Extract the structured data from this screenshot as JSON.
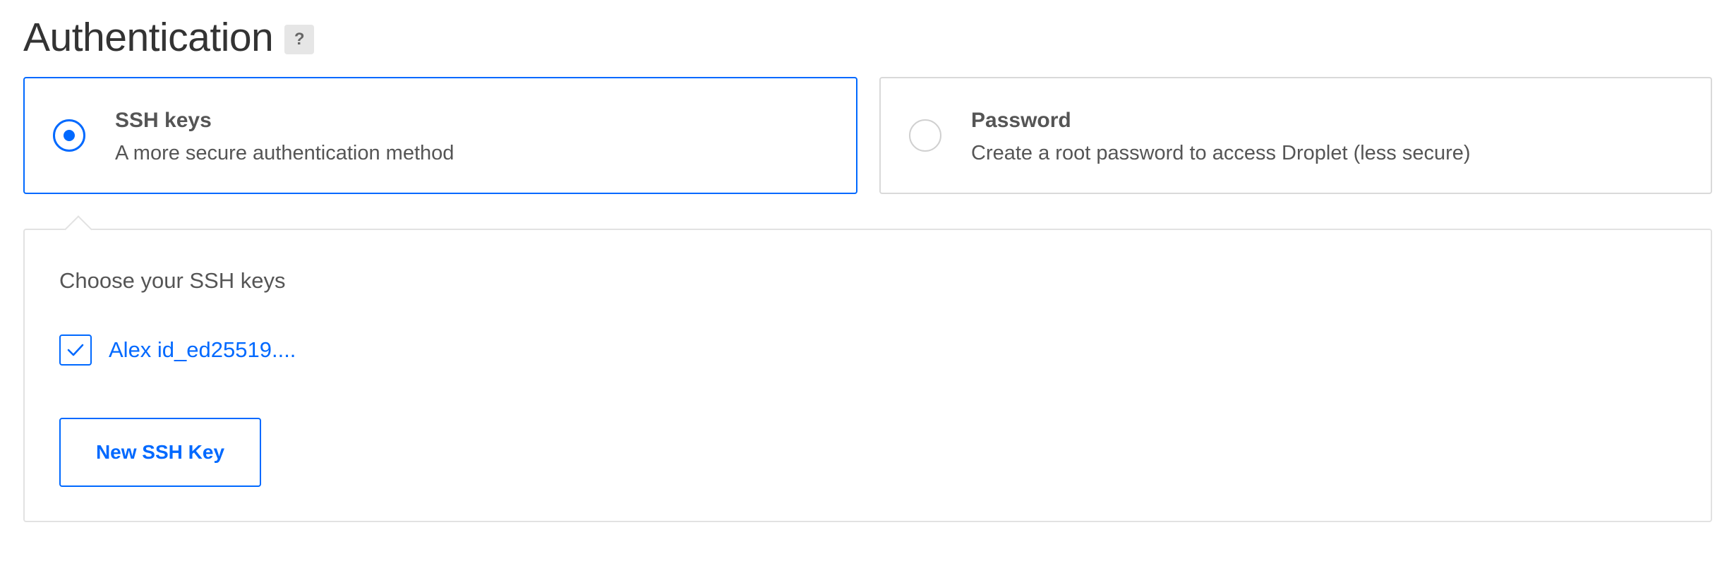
{
  "heading": {
    "title": "Authentication",
    "help_label": "?"
  },
  "options": [
    {
      "title": "SSH keys",
      "description": "A more secure authentication method",
      "selected": true
    },
    {
      "title": "Password",
      "description": "Create a root password to access Droplet (less secure)",
      "selected": false
    }
  ],
  "ssh_panel": {
    "label": "Choose your SSH keys",
    "keys": [
      {
        "name": "Alex id_ed25519....",
        "checked": true
      }
    ],
    "new_key_button": "New SSH Key"
  },
  "colors": {
    "accent": "#0069ff",
    "border": "#d9d9d9",
    "text": "#555555"
  },
  "icons": {
    "help": "question-mark-icon",
    "check": "checkmark-icon"
  }
}
